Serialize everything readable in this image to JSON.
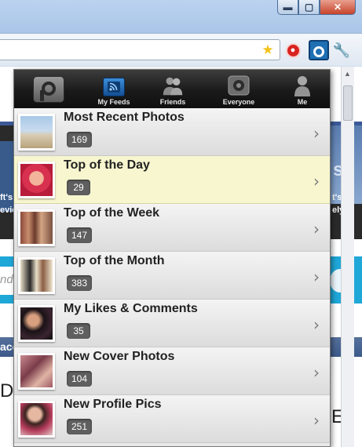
{
  "window": {
    "minimize_glyph": "▬",
    "maximize_glyph": "▢",
    "close_glyph": "✕"
  },
  "toolbar": {
    "icons": [
      "star-icon",
      "stop-icon",
      "popup-extension-icon",
      "wrench-icon"
    ]
  },
  "background_page": {
    "ad_left_text": [
      "ft's",
      "evic"
    ],
    "ad_right_text": [
      "s",
      "t's",
      "ely"
    ],
    "search_placeholder_fragment": "nd",
    "nav_fragment": "ace",
    "left_big_fragment": "DO",
    "right_big_fragment": "E"
  },
  "popup": {
    "nav": {
      "tabs": [
        {
          "label": "My Feeds",
          "icon": "rss-feed-icon",
          "active": true
        },
        {
          "label": "Friends",
          "icon": "friends-icon",
          "active": false
        },
        {
          "label": "Everyone",
          "icon": "everyone-icon",
          "active": false
        },
        {
          "label": "Me",
          "icon": "person-icon",
          "active": false
        }
      ]
    },
    "feeds": [
      {
        "title": "Most Recent Photos",
        "count": "169",
        "highlighted": false
      },
      {
        "title": "Top of the Day",
        "count": "29",
        "highlighted": true
      },
      {
        "title": "Top of the Week",
        "count": "147",
        "highlighted": false
      },
      {
        "title": "Top of the Month",
        "count": "383",
        "highlighted": false
      },
      {
        "title": "My Likes & Comments",
        "count": "35",
        "highlighted": false
      },
      {
        "title": "New Cover Photos",
        "count": "104",
        "highlighted": false
      },
      {
        "title": "New Profile Pics",
        "count": "251",
        "highlighted": false
      }
    ]
  },
  "colors": {
    "highlight": "#f7f6cf",
    "count_badge": "#5f5f5f",
    "active_tab": "#2574c4",
    "nav_bar": "#1a1a1a"
  }
}
